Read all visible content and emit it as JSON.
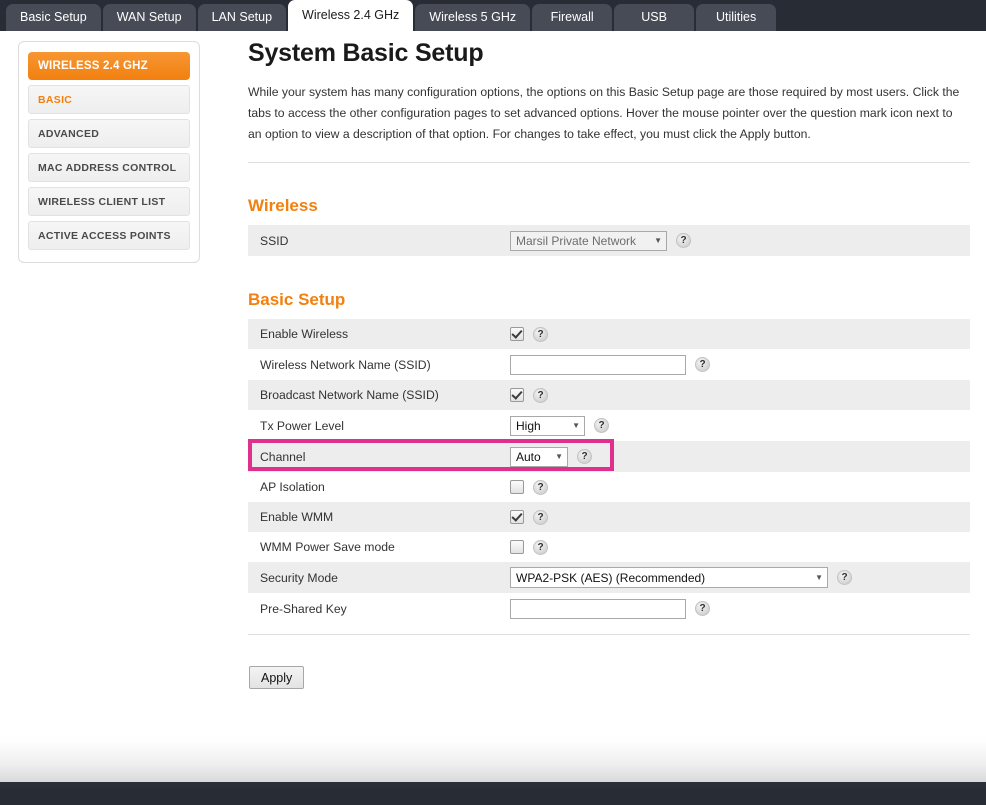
{
  "tabs": [
    {
      "label": "Basic Setup",
      "active": false
    },
    {
      "label": "WAN Setup",
      "active": false
    },
    {
      "label": "LAN Setup",
      "active": false
    },
    {
      "label": "Wireless 2.4 GHz",
      "active": true
    },
    {
      "label": "Wireless 5 GHz",
      "active": false
    },
    {
      "label": "Firewall",
      "active": false
    },
    {
      "label": "USB",
      "active": false
    },
    {
      "label": "Utilities",
      "active": false
    }
  ],
  "sidebar": {
    "header": "WIRELESS 2.4 GHZ",
    "items": [
      {
        "label": "BASIC",
        "active": true
      },
      {
        "label": "ADVANCED",
        "active": false
      },
      {
        "label": "MAC ADDRESS CONTROL",
        "active": false
      },
      {
        "label": "WIRELESS CLIENT LIST",
        "active": false
      },
      {
        "label": "ACTIVE ACCESS POINTS",
        "active": false
      }
    ]
  },
  "main": {
    "title": "System Basic Setup",
    "description": "While your system has many configuration options, the options on this Basic Setup page are those required by most users. Click the tabs to access the other configuration pages to set advanced options. Hover the mouse pointer over the question mark icon next to an option to view a description of that option. For changes to take effect, you must click the Apply button.",
    "wireless_section_title": "Wireless",
    "basic_section_title": "Basic Setup",
    "help_glyph": "?",
    "caret_glyph": "▼",
    "apply_label": "Apply"
  },
  "wireless": {
    "ssid_label": "SSID",
    "ssid_value": "Marsil Private Network"
  },
  "basic": {
    "enable_wireless_label": "Enable Wireless",
    "enable_wireless_checked": true,
    "network_name_label": "Wireless Network Name (SSID)",
    "network_name_value": "",
    "broadcast_label": "Broadcast Network Name (SSID)",
    "broadcast_checked": true,
    "tx_power_label": "Tx Power Level",
    "tx_power_value": "High",
    "channel_label": "Channel",
    "channel_value": "Auto",
    "ap_isolation_label": "AP Isolation",
    "ap_isolation_checked": false,
    "enable_wmm_label": "Enable WMM",
    "enable_wmm_checked": true,
    "wmm_power_save_label": "WMM Power Save mode",
    "wmm_power_save_checked": false,
    "security_mode_label": "Security Mode",
    "security_mode_value": "WPA2-PSK (AES) (Recommended)",
    "psk_label": "Pre-Shared Key",
    "psk_value": ""
  },
  "highlight": {
    "color": "#e0308e",
    "target": "Channel"
  }
}
